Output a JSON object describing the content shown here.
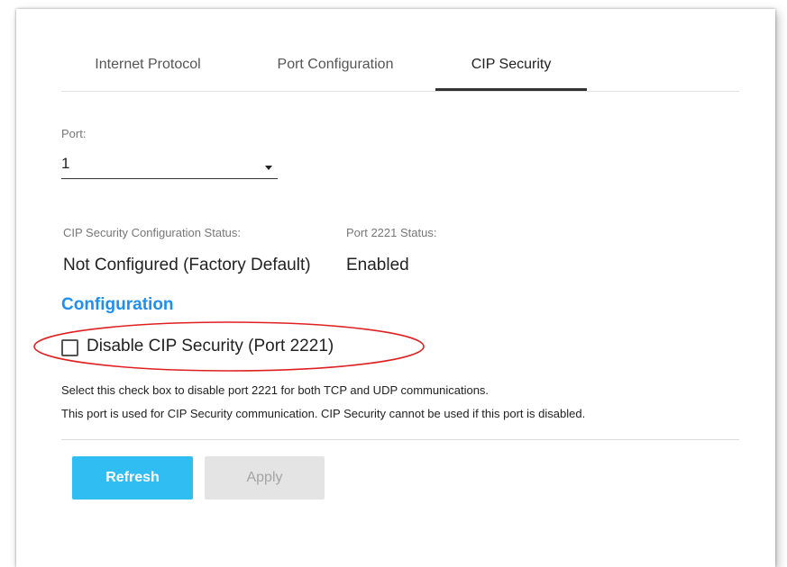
{
  "tabs": [
    {
      "label": "Internet Protocol",
      "active": false
    },
    {
      "label": "Port Configuration",
      "active": false
    },
    {
      "label": "CIP Security",
      "active": true
    }
  ],
  "port": {
    "label": "Port:",
    "value": "1"
  },
  "status": {
    "config_label": "CIP Security Configuration Status:",
    "config_value": "Not Configured (Factory Default)",
    "port_label": "Port 2221 Status:",
    "port_value": "Enabled"
  },
  "configuration": {
    "heading": "Configuration",
    "checkbox_label": "Disable CIP Security (Port 2221)",
    "checkbox_checked": false,
    "help_line1": "Select this check box to disable port 2221 for both TCP and UDP communications.",
    "help_line2": "This port is used for CIP Security communication. CIP Security cannot be used if this port is disabled."
  },
  "buttons": {
    "refresh": "Refresh",
    "apply": "Apply"
  },
  "colors": {
    "accent": "#1e8ef0",
    "refresh_button": "#30bdf2",
    "highlight_circle": "#e02020"
  }
}
